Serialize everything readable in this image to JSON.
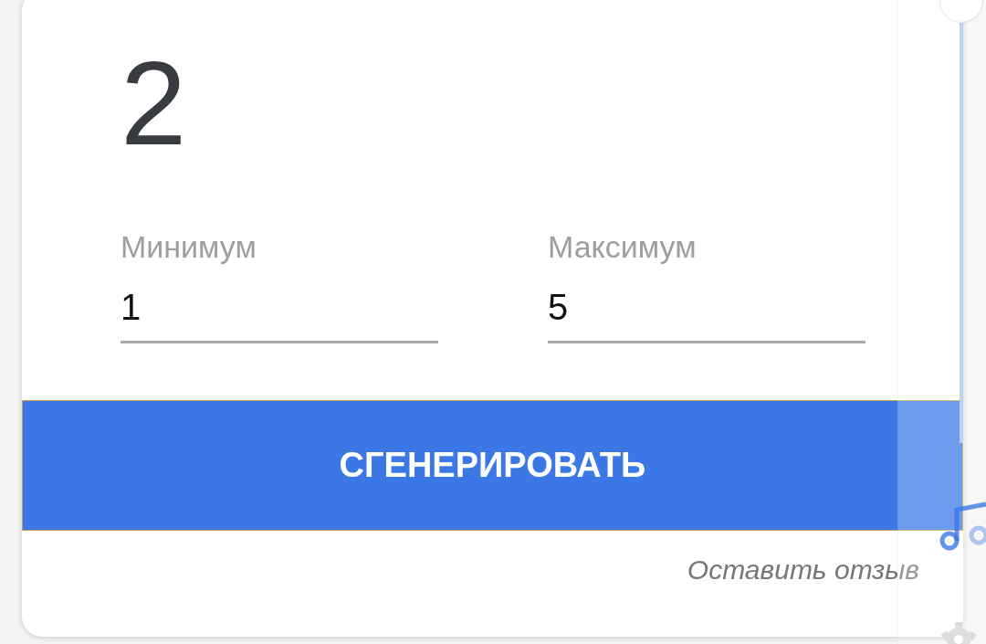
{
  "result": "2",
  "fields": [
    {
      "label": "Минимум",
      "value": "1"
    },
    {
      "label": "Максимум",
      "value": "5"
    }
  ],
  "button": "СГЕНЕРИРОВАТЬ",
  "feedback_link": "Оставить отзыв"
}
